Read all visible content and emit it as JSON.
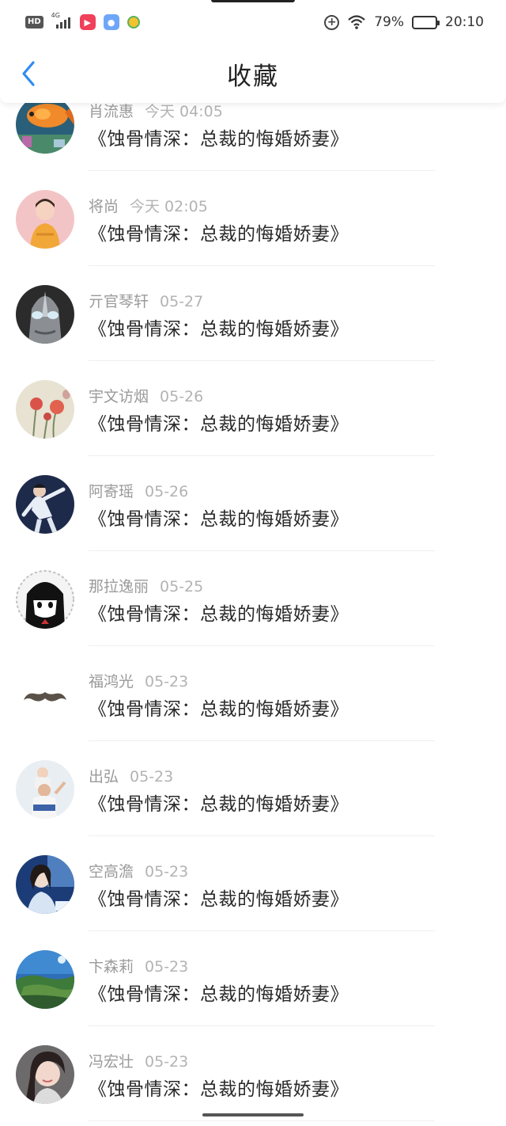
{
  "status_bar": {
    "hd": "HD",
    "network": "4G",
    "battery_percent": "79%",
    "battery_level": 0.79,
    "time": "20:10"
  },
  "nav": {
    "title": "收藏"
  },
  "favorites": [
    {
      "user": "肖流惠",
      "date": "今天 04:05",
      "title": "《蚀骨情深：总裁的悔婚娇妻》",
      "avatar": "goldfish"
    },
    {
      "user": "将尚",
      "date": "今天 02:05",
      "title": "《蚀骨情深：总裁的悔婚娇妻》",
      "avatar": "girl-pink"
    },
    {
      "user": "亓官琴轩",
      "date": "05-27",
      "title": "《蚀骨情深：总裁的悔婚娇妻》",
      "avatar": "ultraman"
    },
    {
      "user": "宇文访烟",
      "date": "05-26",
      "title": "《蚀骨情深：总裁的悔婚娇妻》",
      "avatar": "poppy"
    },
    {
      "user": "阿寄瑶",
      "date": "05-26",
      "title": "《蚀骨情深：总裁的悔婚娇妻》",
      "avatar": "dancer"
    },
    {
      "user": "那拉逸丽",
      "date": "05-25",
      "title": "《蚀骨情深：总裁的悔婚娇妻》",
      "avatar": "anime-girl"
    },
    {
      "user": "福鸿光",
      "date": "05-23",
      "title": "《蚀骨情深：总裁的悔婚娇妻》",
      "avatar": "mustache"
    },
    {
      "user": "出弘",
      "date": "05-23",
      "title": "《蚀骨情深：总裁的悔婚娇妻》",
      "avatar": "father-child"
    },
    {
      "user": "空高澹",
      "date": "05-23",
      "title": "《蚀骨情深：总裁的悔婚娇妻》",
      "avatar": "woman-blue"
    },
    {
      "user": "卞森莉",
      "date": "05-23",
      "title": "《蚀骨情深：总裁的悔婚娇妻》",
      "avatar": "landscape"
    },
    {
      "user": "冯宏壮",
      "date": "05-23",
      "title": "《蚀骨情深：总裁的悔婚娇妻》",
      "avatar": "portrait"
    }
  ],
  "colors": {
    "accent": "#2f8cf0",
    "text_primary": "#2a2a2a",
    "text_secondary": "#9a9a9a"
  }
}
